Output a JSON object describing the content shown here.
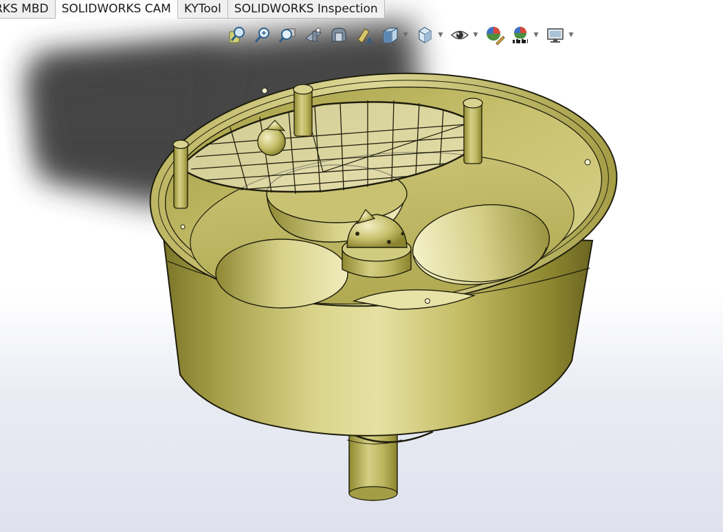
{
  "tabs": [
    {
      "label": "RKS MBD"
    },
    {
      "label": "SOLIDWORKS CAM"
    },
    {
      "label": "KYTool"
    },
    {
      "label": "SOLIDWORKS Inspection"
    }
  ],
  "active_tab": "SOLIDWORKS CAM",
  "heads_up_toolbar": [
    {
      "icon": "zoom-to-fit-icon"
    },
    {
      "icon": "zoom-to-area-icon"
    },
    {
      "icon": "previous-view-icon"
    },
    {
      "icon": "section-view-icon"
    },
    {
      "icon": "dynamic-annotation-views-icon"
    },
    {
      "icon": "apply-scene-icon"
    },
    {
      "icon": "view-orientation-icon",
      "dropdown": true
    },
    {
      "icon": "display-style-icon",
      "dropdown": true
    },
    {
      "icon": "hide-show-items-icon",
      "dropdown": true
    },
    {
      "icon": "edit-appearance-icon"
    },
    {
      "icon": "apply-scene-icon",
      "dropdown": true
    },
    {
      "icon": "view-settings-icon",
      "dropdown": true
    }
  ],
  "colors": {
    "part": "#b9b054",
    "part_highlight": "#e9e3a1",
    "part_shadow": "#6b6522",
    "edge": "#1a1a0c",
    "shadow": "#3a3a3a",
    "background_bottom": "#dfe2ee"
  }
}
